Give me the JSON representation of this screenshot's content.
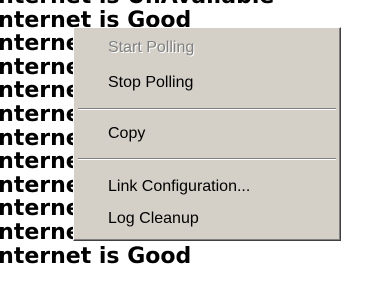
{
  "log": {
    "lines": [
      "Internet is UnAvailable",
      "Internet is Good",
      "Internet is Good",
      "Internet is Good",
      "Internet is Good",
      "Internet is Good",
      "Internet is Good",
      "Internet is Good",
      "Internet is Good",
      "Internet is Good",
      "Internet is UnAvailable",
      "Internet is Good"
    ]
  },
  "context_menu": {
    "start_polling": "Start Polling",
    "stop_polling": "Stop Polling",
    "copy": "Copy",
    "link_configuration": "Link Configuration...",
    "log_cleanup": "Log Cleanup",
    "disabled_items": [
      "Start Polling"
    ]
  },
  "colors": {
    "menu_background": "#d4d0c8",
    "disabled_text": "#808080",
    "log_text": "#000000"
  }
}
